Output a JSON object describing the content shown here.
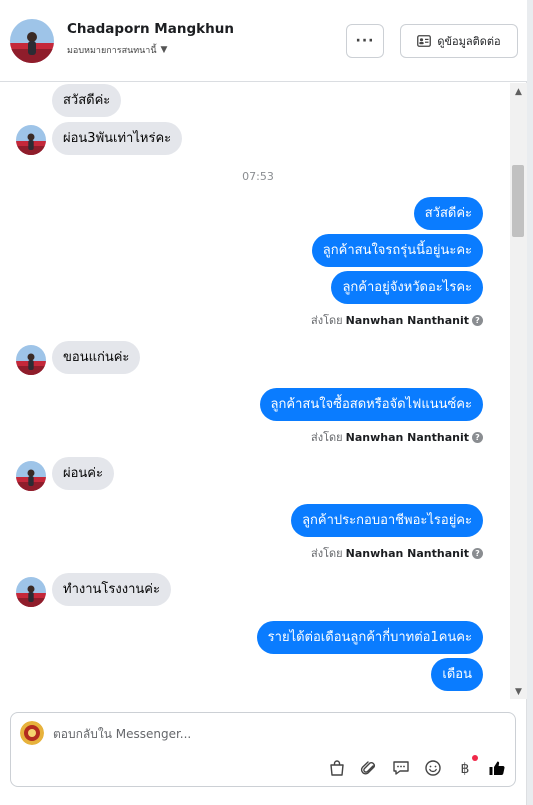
{
  "header": {
    "name": "Chadaporn Mangkhun",
    "assign_label": "มอบหมายการสนทนานี้",
    "more_label": "···",
    "contact_label": "ดูข้อมูลติดต่อ"
  },
  "messages": {
    "m1": "สวัสดีค่ะ",
    "m2": "ผ่อน3พันเท่าไหร่คะ",
    "time1": "07:53",
    "o1": "สวัสดีค่ะ",
    "o2": "ลูกค้าสนใจรถรุ่นนี้อยู่นะคะ",
    "o3": "ลูกค้าอยู่จังหวัดอะไรคะ",
    "m3": "ขอนแก่นค่ะ",
    "o4": "ลูกค้าสนใจซื้อสดหรือจัดไฟแนนซ์คะ",
    "m4": "ผ่อนค่ะ",
    "o5": "ลูกค้าประกอบอาชีพอะไรอยู่คะ",
    "m5": "ทำงานโรงงานค่ะ",
    "o6": "รายได้ต่อเดือนลูกค้ากี่บาทต่อ1คนคะ",
    "o7": "เดือน"
  },
  "sent_by": {
    "prefix": "ส่งโดย",
    "agent": "Nanwhan Nanthanit"
  },
  "composer": {
    "placeholder": "ตอบกลับใน Messenger..."
  },
  "icons": [
    "avatar-photo",
    "more-icon",
    "contact-card-icon",
    "caret-down-icon",
    "info-icon",
    "shopping-bag-icon",
    "paperclip-icon",
    "chat-bubble-icon",
    "emoji-icon",
    "baht-icon",
    "thumbs-up-icon"
  ],
  "colors": {
    "outgoing_bubble": "#0a7cff",
    "incoming_bubble": "#e4e6eb",
    "thumbs_up": "#050505"
  }
}
